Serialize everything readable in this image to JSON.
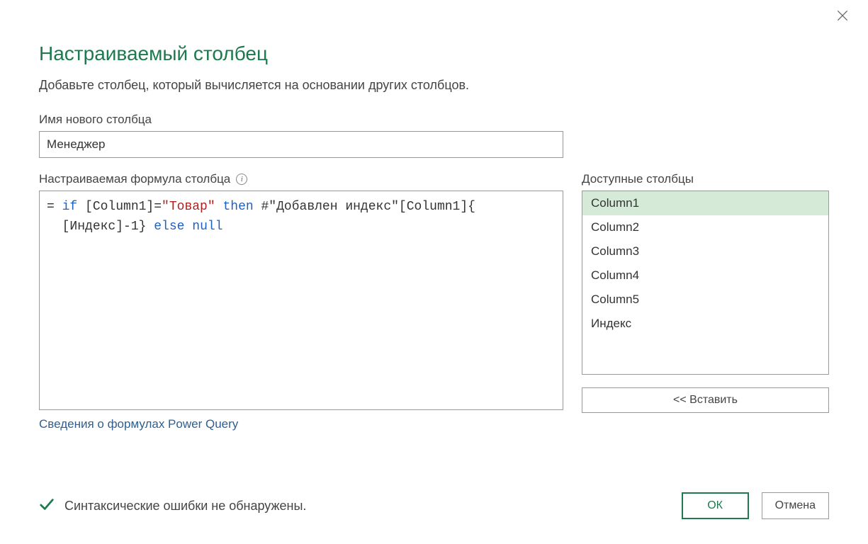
{
  "dialog": {
    "title": "Настраиваемый столбец",
    "subtitle": "Добавьте столбец, который вычисляется на основании других столбцов."
  },
  "new_column": {
    "label": "Имя нового столбца",
    "value": "Менеджер"
  },
  "formula": {
    "label": "Настраиваемая формула столбца",
    "prefix": "= ",
    "kw_if": "if",
    "part1": " [Column1]=",
    "str1": "\"Товар\"",
    "part2": " ",
    "kw_then": "then",
    "part3": " #\"Добавлен индекс\"[Column1]{",
    "line2_a": "[Индекс]-1} ",
    "kw_else": "else",
    "line2_b": " ",
    "kw_null": "null"
  },
  "help_link": "Сведения о формулах Power Query",
  "available": {
    "label": "Доступные столбцы",
    "items": [
      "Column1",
      "Column2",
      "Column3",
      "Column4",
      "Column5",
      "Индекс"
    ],
    "selected_index": 0
  },
  "insert_button": "<< Вставить",
  "status": {
    "text": "Синтаксические ошибки не обнаружены."
  },
  "buttons": {
    "ok": "ОК",
    "cancel": "Отмена"
  }
}
